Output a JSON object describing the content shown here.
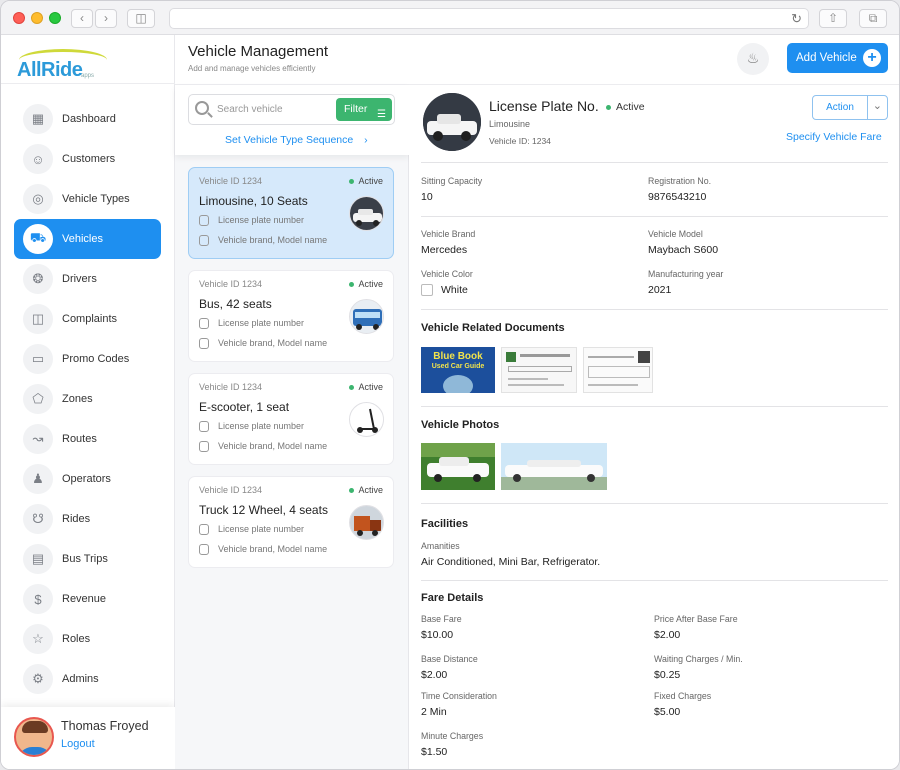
{
  "app": {
    "logo_text": "AllRide",
    "logo_sub": "apps"
  },
  "sidebar": {
    "items": [
      {
        "label": "Dashboard",
        "icon": "dashboard-icon"
      },
      {
        "label": "Customers",
        "icon": "person-icon"
      },
      {
        "label": "Vehicle Types",
        "icon": "vehicle-type-icon"
      },
      {
        "label": "Vehicles",
        "icon": "car-icon",
        "active": true
      },
      {
        "label": "Drivers",
        "icon": "steering-wheel-icon"
      },
      {
        "label": "Complaints",
        "icon": "complaints-icon"
      },
      {
        "label": "Promo Codes",
        "icon": "ticket-icon"
      },
      {
        "label": "Zones",
        "icon": "zones-icon"
      },
      {
        "label": "Routes",
        "icon": "route-icon"
      },
      {
        "label": "Operators",
        "icon": "operator-icon"
      },
      {
        "label": "Rides",
        "icon": "scooter-icon"
      },
      {
        "label": "Bus Trips",
        "icon": "bus-icon"
      },
      {
        "label": "Revenue",
        "icon": "money-bag-icon"
      },
      {
        "label": "Roles",
        "icon": "trophy-icon"
      },
      {
        "label": "Admins",
        "icon": "gear-icon"
      }
    ],
    "user": {
      "name": "Thomas Froyed",
      "logout": "Logout"
    }
  },
  "header": {
    "title": "Vehicle Management",
    "subtitle": "Add and manage vehicles efficiently",
    "add_button": "Add Vehicle"
  },
  "list": {
    "search_placeholder": "Search vehicle",
    "filter_label": "Filter",
    "sequence_link": "Set Vehicle Type Sequence",
    "vehicles": [
      {
        "id": "Vehicle ID 1234",
        "status": "Active",
        "title": "Limousine, 10 Seats",
        "plate": "License plate number",
        "brand": "Vehicle brand, Model name"
      },
      {
        "id": "Vehicle ID 1234",
        "status": "Active",
        "title": "Bus, 42 seats",
        "plate": "License plate number",
        "brand": "Vehicle brand, Model name"
      },
      {
        "id": "Vehicle ID 1234",
        "status": "Active",
        "title": "E-scooter, 1 seat",
        "plate": "License plate number",
        "brand": "Vehicle brand, Model name"
      },
      {
        "id": "Vehicle ID 1234",
        "status": "Active",
        "title": "Truck 12 Wheel, 4 seats",
        "plate": "License plate number",
        "brand": "Vehicle brand, Model name"
      }
    ]
  },
  "detail": {
    "plate_title": "License Plate No.",
    "status": "Active",
    "type": "Limousine",
    "vehicle_id": "Vehicle ID: 1234",
    "action_label": "Action",
    "fare_link": "Specify Vehicle Fare",
    "fields": {
      "sitting_capacity_label": "Sitting Capacity",
      "sitting_capacity": "10",
      "registration_label": "Registration No.",
      "registration": "9876543210",
      "brand_label": "Vehicle Brand",
      "brand": "Mercedes",
      "model_label": "Vehicle Model",
      "model": "Maybach S600",
      "color_label": "Vehicle Color",
      "color": "White",
      "year_label": "Manufacturing year",
      "year": "2021"
    },
    "documents_title": "Vehicle Related Documents",
    "documents": {
      "blue_book_line1": "Blue Book",
      "blue_book_line2": "Used Car Guide"
    },
    "photos_title": "Vehicle Photos",
    "facilities_title": "Facilities",
    "amenities_label": "Amanities",
    "amenities": "Air Conditioned, Mini Bar, Refrigerator.",
    "fare_title": "Fare Details",
    "fare": {
      "base_fare_label": "Base Fare",
      "base_fare": "$10.00",
      "price_after_label": "Price After Base Fare",
      "price_after": "$2.00",
      "base_distance_label": "Base Distance",
      "base_distance": "$2.00",
      "waiting_label": "Waiting Charges / Min.",
      "waiting": "$0.25",
      "time_label": "Time Consideration",
      "time": "2 Min",
      "fixed_label": "Fixed Charges",
      "fixed": "$5.00",
      "minute_label": "Minute Charges",
      "minute": "$1.50"
    }
  },
  "colors": {
    "accent": "#1e8ff0",
    "status_active": "#3cb56f",
    "filter": "#3cb56f"
  }
}
